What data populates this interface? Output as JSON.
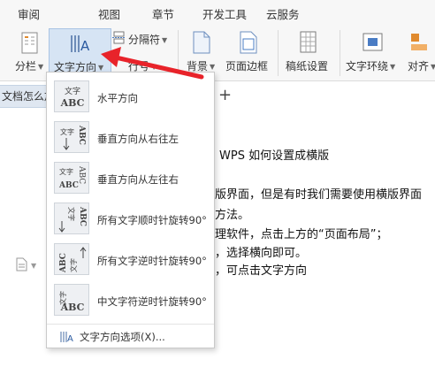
{
  "menu_tabs": [
    "审阅",
    "视图",
    "章节",
    "开发工具",
    "云服务"
  ],
  "ribbon": {
    "fengan": "分栏",
    "text_direction": "文字方向",
    "separator": "分隔符",
    "hangeng_partial": "行号",
    "background": "背景",
    "page_border": "页面边框",
    "manuscript": "稿纸设置",
    "text_wrap": "文字环绕",
    "align": "对齐"
  },
  "doc_tab": {
    "title": "文档怎么加"
  },
  "dropdown": {
    "items": [
      {
        "label": "水平方向",
        "icon": "horizontal-text-icon"
      },
      {
        "label": "垂直方向从右往左",
        "icon": "vertical-rtl-icon"
      },
      {
        "label": "垂直方向从左往右",
        "icon": "vertical-ltr-icon"
      },
      {
        "label": "所有文字顺时针旋转90°",
        "icon": "rotate-cw-icon"
      },
      {
        "label": "所有文字逆时针旋转90°",
        "icon": "rotate-ccw-icon"
      },
      {
        "label": "中文字符逆时针旋转90°",
        "icon": "cjk-rotate-ccw-icon"
      }
    ],
    "options_label": "文字方向选项(X)..."
  },
  "icon_text": {
    "wen_zi": "文字",
    "abc": "ABC"
  },
  "document": {
    "lines": [
      "WPS 如何设置成横版",
      "版界面，但是有时我们需要使用横版界面",
      "方法。",
      "理软件，点击上方的“页面布局”；",
      "，选择横向即可。",
      "，可点击文字方向"
    ]
  },
  "colors": {
    "annotation_arrow": "#e8232a",
    "accent": "#2b6cc4"
  }
}
